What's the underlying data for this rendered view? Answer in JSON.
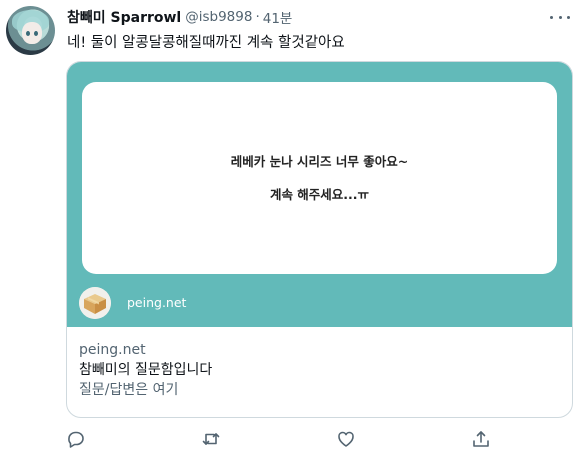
{
  "tweet": {
    "author_name": "참빼미 Sparrowl",
    "handle": "@isb9898",
    "separator": "·",
    "time": "41분",
    "text": "네! 둘이 알콩달콩해질때까진 계속 할것같아요"
  },
  "card": {
    "background_color": "#62bab9",
    "question_lines": [
      "레베카 눈나 시리즈 너무 좋아요~",
      "계속 해주세요...ㅠ"
    ],
    "site_name": "peing.net",
    "domain": "peing.net",
    "title": "참빼미의 질문함입니다",
    "description": "질문/답변은 여기"
  },
  "actions": {
    "icons": [
      "reply-icon",
      "retweet-icon",
      "like-icon",
      "share-icon"
    ]
  }
}
